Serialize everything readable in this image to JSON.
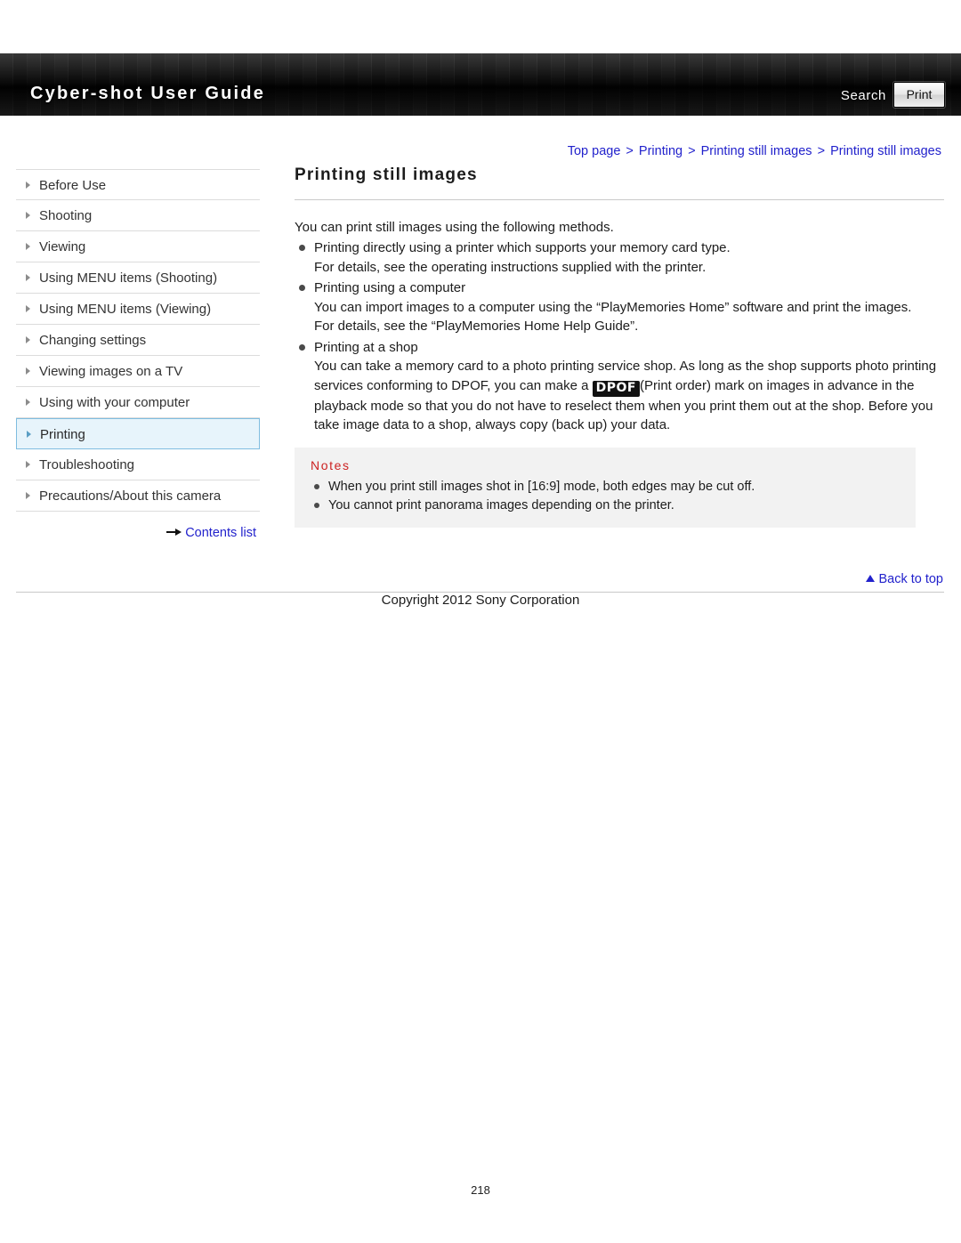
{
  "header": {
    "title": "Cyber-shot User Guide",
    "search_label": "Search",
    "print_label": "Print"
  },
  "breadcrumb": {
    "items": [
      "Top page",
      "Printing",
      "Printing still images",
      "Printing still images"
    ],
    "separator": ">"
  },
  "sidebar": {
    "items": [
      {
        "label": "Before Use",
        "active": false
      },
      {
        "label": "Shooting",
        "active": false
      },
      {
        "label": "Viewing",
        "active": false
      },
      {
        "label": "Using MENU items (Shooting)",
        "active": false
      },
      {
        "label": "Using MENU items (Viewing)",
        "active": false
      },
      {
        "label": "Changing settings",
        "active": false
      },
      {
        "label": "Viewing images on a TV",
        "active": false
      },
      {
        "label": "Using with your computer",
        "active": false
      },
      {
        "label": "Printing",
        "active": true
      },
      {
        "label": "Troubleshooting",
        "active": false
      },
      {
        "label": "Precautions/About this camera",
        "active": false
      }
    ],
    "contents_list_label": "Contents list"
  },
  "main": {
    "title": "Printing still images",
    "intro": "You can print still images using the following methods.",
    "methods": [
      {
        "head": "Printing directly using a printer which supports your memory card type.",
        "body": "For details, see the operating instructions supplied with the printer."
      },
      {
        "head": "Printing using a computer",
        "body": "You can import images to a computer using the “PlayMemories Home” software and print the images.\nFor details, see the “PlayMemories Home Help Guide”."
      },
      {
        "head": "Printing at a shop",
        "body_part1": "You can take a memory card to a photo printing service shop. As long as the shop supports photo printing services conforming to DPOF, you can make a ",
        "dpof_badge": "DPOF",
        "body_part2": "(Print order) mark on images in advance in the playback mode so that you do not have to reselect them when you print them out at the shop. Before you take image data to a shop, always copy (back up) your data."
      }
    ],
    "notes": {
      "title": "Notes",
      "items": [
        "When you print still images shot in [16:9] mode, both edges may be cut off.",
        "You cannot print panorama images depending on the printer."
      ]
    },
    "back_to_top": "Back to top"
  },
  "footer": {
    "copyright": "Copyright 2012 Sony Corporation",
    "page_number": "218"
  }
}
